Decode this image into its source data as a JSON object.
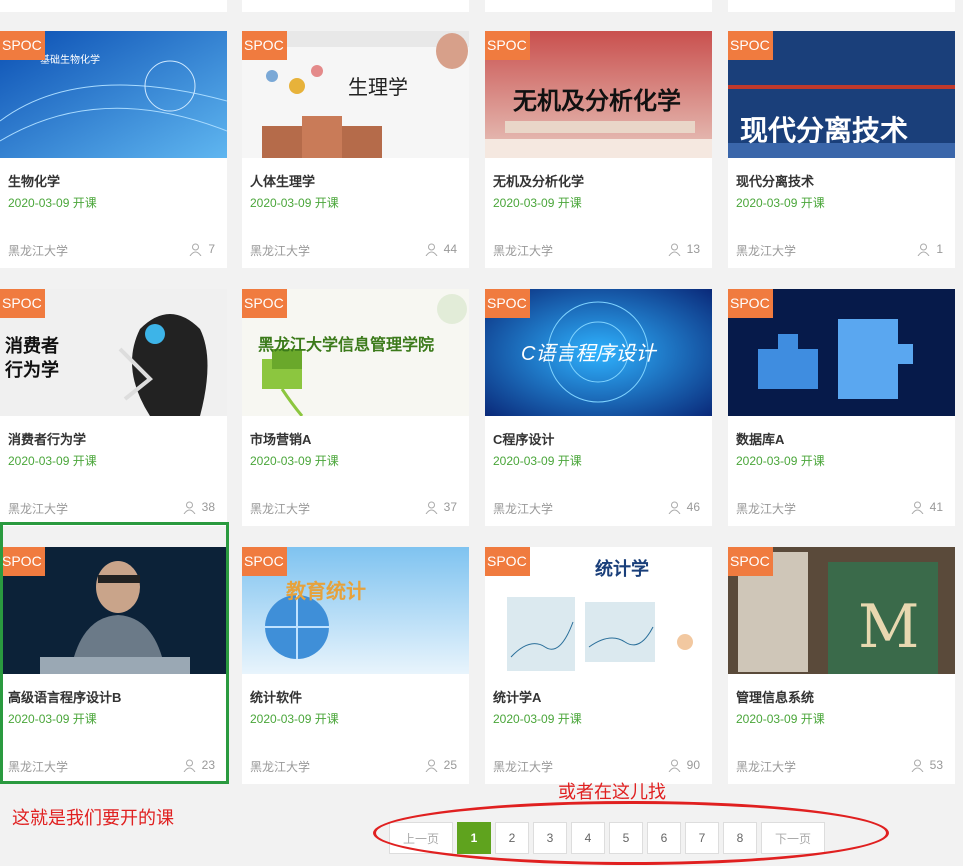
{
  "courses": [
    {
      "badge": "SPOC",
      "title": "生物化学",
      "date": "2020-03-09 开课",
      "school": "黑龙江大学",
      "students": "7",
      "thumb_text": "基础生物化学"
    },
    {
      "badge": "SPOC",
      "title": "人体生理学",
      "date": "2020-03-09 开课",
      "school": "黑龙江大学",
      "students": "44",
      "thumb_text": "生理学"
    },
    {
      "badge": "SPOC",
      "title": "无机及分析化学",
      "date": "2020-03-09 开课",
      "school": "黑龙江大学",
      "students": "13",
      "thumb_text": "无机及分析化学"
    },
    {
      "badge": "SPOC",
      "title": "现代分离技术",
      "date": "2020-03-09 开课",
      "school": "黑龙江大学",
      "students": "1",
      "thumb_text": "现代分离技术"
    },
    {
      "badge": "SPOC",
      "title": "消费者行为学",
      "date": "2020-03-09 开课",
      "school": "黑龙江大学",
      "students": "38",
      "thumb_text": "消费者行为学"
    },
    {
      "badge": "SPOC",
      "title": "市场营销A",
      "date": "2020-03-09 开课",
      "school": "黑龙江大学",
      "students": "37",
      "thumb_text": "黑龙江大学信息管理学院"
    },
    {
      "badge": "SPOC",
      "title": "C程序设计",
      "date": "2020-03-09 开课",
      "school": "黑龙江大学",
      "students": "46",
      "thumb_text": "C语言程序设计"
    },
    {
      "badge": "SPOC",
      "title": "数据库A",
      "date": "2020-03-09 开课",
      "school": "黑龙江大学",
      "students": "41",
      "thumb_text": ""
    },
    {
      "badge": "SPOC",
      "title": "高级语言程序设计B",
      "date": "2020-03-09 开课",
      "school": "黑龙江大学",
      "students": "23",
      "thumb_text": ""
    },
    {
      "badge": "SPOC",
      "title": "统计软件",
      "date": "2020-03-09 开课",
      "school": "黑龙江大学",
      "students": "25",
      "thumb_text": "教育统计"
    },
    {
      "badge": "SPOC",
      "title": "统计学A",
      "date": "2020-03-09 开课",
      "school": "黑龙江大学",
      "students": "90",
      "thumb_text": "统计学"
    },
    {
      "badge": "SPOC",
      "title": "管理信息系统",
      "date": "2020-03-09 开课",
      "school": "黑龙江大学",
      "students": "53",
      "thumb_text": ""
    }
  ],
  "annotations": {
    "left_note": "这就是我们要开的课",
    "pager_note": "或者在这儿找"
  },
  "pagination": {
    "prev": "上一页",
    "next": "下一页",
    "pages": [
      "1",
      "2",
      "3",
      "4",
      "5",
      "6",
      "7",
      "8"
    ],
    "active": "1"
  },
  "colors": {
    "badge": "#f07b3f",
    "date": "#4aa63a",
    "active_page": "#5fa31e",
    "annotation": "#e02020",
    "highlight": "#2a9a3f"
  }
}
